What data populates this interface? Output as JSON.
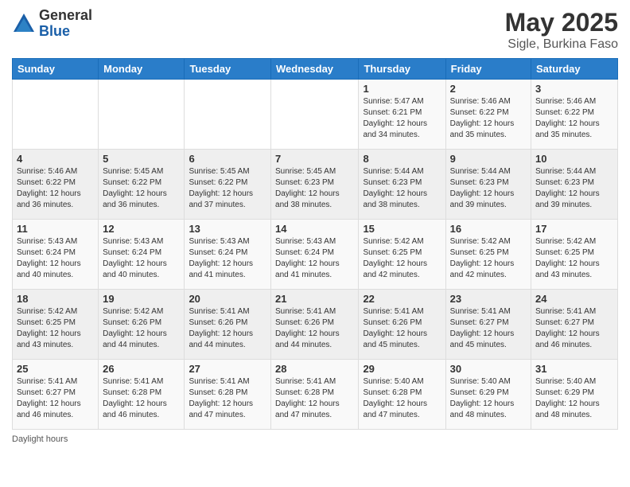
{
  "logo": {
    "general": "General",
    "blue": "Blue"
  },
  "title": "May 2025",
  "location": "Sigle, Burkina Faso",
  "days_of_week": [
    "Sunday",
    "Monday",
    "Tuesday",
    "Wednesday",
    "Thursday",
    "Friday",
    "Saturday"
  ],
  "footer": "Daylight hours",
  "weeks": [
    [
      {
        "day": "",
        "info": ""
      },
      {
        "day": "",
        "info": ""
      },
      {
        "day": "",
        "info": ""
      },
      {
        "day": "",
        "info": ""
      },
      {
        "day": "1",
        "info": "Sunrise: 5:47 AM\nSunset: 6:21 PM\nDaylight: 12 hours\nand 34 minutes."
      },
      {
        "day": "2",
        "info": "Sunrise: 5:46 AM\nSunset: 6:22 PM\nDaylight: 12 hours\nand 35 minutes."
      },
      {
        "day": "3",
        "info": "Sunrise: 5:46 AM\nSunset: 6:22 PM\nDaylight: 12 hours\nand 35 minutes."
      }
    ],
    [
      {
        "day": "4",
        "info": "Sunrise: 5:46 AM\nSunset: 6:22 PM\nDaylight: 12 hours\nand 36 minutes."
      },
      {
        "day": "5",
        "info": "Sunrise: 5:45 AM\nSunset: 6:22 PM\nDaylight: 12 hours\nand 36 minutes."
      },
      {
        "day": "6",
        "info": "Sunrise: 5:45 AM\nSunset: 6:22 PM\nDaylight: 12 hours\nand 37 minutes."
      },
      {
        "day": "7",
        "info": "Sunrise: 5:45 AM\nSunset: 6:23 PM\nDaylight: 12 hours\nand 38 minutes."
      },
      {
        "day": "8",
        "info": "Sunrise: 5:44 AM\nSunset: 6:23 PM\nDaylight: 12 hours\nand 38 minutes."
      },
      {
        "day": "9",
        "info": "Sunrise: 5:44 AM\nSunset: 6:23 PM\nDaylight: 12 hours\nand 39 minutes."
      },
      {
        "day": "10",
        "info": "Sunrise: 5:44 AM\nSunset: 6:23 PM\nDaylight: 12 hours\nand 39 minutes."
      }
    ],
    [
      {
        "day": "11",
        "info": "Sunrise: 5:43 AM\nSunset: 6:24 PM\nDaylight: 12 hours\nand 40 minutes."
      },
      {
        "day": "12",
        "info": "Sunrise: 5:43 AM\nSunset: 6:24 PM\nDaylight: 12 hours\nand 40 minutes."
      },
      {
        "day": "13",
        "info": "Sunrise: 5:43 AM\nSunset: 6:24 PM\nDaylight: 12 hours\nand 41 minutes."
      },
      {
        "day": "14",
        "info": "Sunrise: 5:43 AM\nSunset: 6:24 PM\nDaylight: 12 hours\nand 41 minutes."
      },
      {
        "day": "15",
        "info": "Sunrise: 5:42 AM\nSunset: 6:25 PM\nDaylight: 12 hours\nand 42 minutes."
      },
      {
        "day": "16",
        "info": "Sunrise: 5:42 AM\nSunset: 6:25 PM\nDaylight: 12 hours\nand 42 minutes."
      },
      {
        "day": "17",
        "info": "Sunrise: 5:42 AM\nSunset: 6:25 PM\nDaylight: 12 hours\nand 43 minutes."
      }
    ],
    [
      {
        "day": "18",
        "info": "Sunrise: 5:42 AM\nSunset: 6:25 PM\nDaylight: 12 hours\nand 43 minutes."
      },
      {
        "day": "19",
        "info": "Sunrise: 5:42 AM\nSunset: 6:26 PM\nDaylight: 12 hours\nand 44 minutes."
      },
      {
        "day": "20",
        "info": "Sunrise: 5:41 AM\nSunset: 6:26 PM\nDaylight: 12 hours\nand 44 minutes."
      },
      {
        "day": "21",
        "info": "Sunrise: 5:41 AM\nSunset: 6:26 PM\nDaylight: 12 hours\nand 44 minutes."
      },
      {
        "day": "22",
        "info": "Sunrise: 5:41 AM\nSunset: 6:26 PM\nDaylight: 12 hours\nand 45 minutes."
      },
      {
        "day": "23",
        "info": "Sunrise: 5:41 AM\nSunset: 6:27 PM\nDaylight: 12 hours\nand 45 minutes."
      },
      {
        "day": "24",
        "info": "Sunrise: 5:41 AM\nSunset: 6:27 PM\nDaylight: 12 hours\nand 46 minutes."
      }
    ],
    [
      {
        "day": "25",
        "info": "Sunrise: 5:41 AM\nSunset: 6:27 PM\nDaylight: 12 hours\nand 46 minutes."
      },
      {
        "day": "26",
        "info": "Sunrise: 5:41 AM\nSunset: 6:28 PM\nDaylight: 12 hours\nand 46 minutes."
      },
      {
        "day": "27",
        "info": "Sunrise: 5:41 AM\nSunset: 6:28 PM\nDaylight: 12 hours\nand 47 minutes."
      },
      {
        "day": "28",
        "info": "Sunrise: 5:41 AM\nSunset: 6:28 PM\nDaylight: 12 hours\nand 47 minutes."
      },
      {
        "day": "29",
        "info": "Sunrise: 5:40 AM\nSunset: 6:28 PM\nDaylight: 12 hours\nand 47 minutes."
      },
      {
        "day": "30",
        "info": "Sunrise: 5:40 AM\nSunset: 6:29 PM\nDaylight: 12 hours\nand 48 minutes."
      },
      {
        "day": "31",
        "info": "Sunrise: 5:40 AM\nSunset: 6:29 PM\nDaylight: 12 hours\nand 48 minutes."
      }
    ]
  ]
}
